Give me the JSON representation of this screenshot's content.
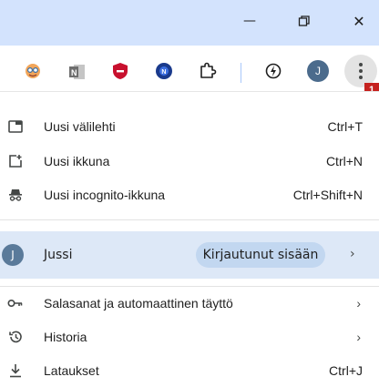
{
  "window": {
    "minimize": "—",
    "restore": "⧉",
    "close": "✕"
  },
  "toolbar": {
    "extensions": [
      "avatar-extension-icon",
      "onenote-extension-icon",
      "shield-extension-icon",
      "blue-badge-extension-icon",
      "puzzle-icon"
    ],
    "profile_initial": "J",
    "badge": "1"
  },
  "menu": {
    "items_top": [
      {
        "icon": "new-tab-icon",
        "label": "Uusi välilehti",
        "shortcut": "Ctrl+T"
      },
      {
        "icon": "new-window-icon",
        "label": "Uusi ikkuna",
        "shortcut": "Ctrl+N"
      },
      {
        "icon": "incognito-icon",
        "label": "Uusi incognito-ikkuna",
        "shortcut": "Ctrl+Shift+N"
      }
    ],
    "profile": {
      "initial": "J",
      "name": "Jussi",
      "status": "Kirjautunut sisään",
      "chevron": "›"
    },
    "items_bottom": [
      {
        "icon": "key-icon",
        "label": "Salasanat ja automaattinen täyttö",
        "chevron": "›"
      },
      {
        "icon": "history-icon",
        "label": "Historia",
        "chevron": "›"
      },
      {
        "icon": "download-icon",
        "label": "Lataukset",
        "shortcut": "Ctrl+J"
      }
    ]
  }
}
